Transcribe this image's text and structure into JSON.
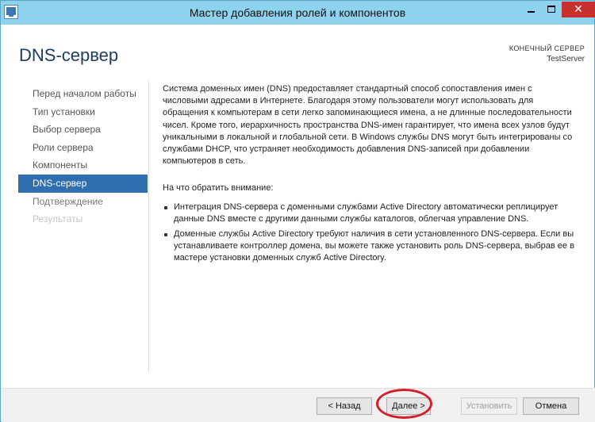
{
  "window": {
    "title": "Мастер добавления ролей и компонентов",
    "controls": {
      "minimize": "",
      "maximize": "",
      "close": "✕"
    }
  },
  "header": {
    "page_title": "DNS-сервер",
    "destination_label": "КОНЕЧНЫЙ СЕРВЕР",
    "destination_value": "TestServer"
  },
  "nav": {
    "items": [
      {
        "label": "Перед началом работы",
        "state": "done"
      },
      {
        "label": "Тип установки",
        "state": "done"
      },
      {
        "label": "Выбор сервера",
        "state": "done"
      },
      {
        "label": "Роли сервера",
        "state": "done"
      },
      {
        "label": "Компоненты",
        "state": "done"
      },
      {
        "label": "DNS-сервер",
        "state": "active"
      },
      {
        "label": "Подтверждение",
        "state": "upcoming"
      },
      {
        "label": "Результаты",
        "state": "disabled"
      }
    ]
  },
  "content": {
    "intro": "Система доменных имен (DNS) предоставляет стандартный способ сопоставления имен с числовыми адресами в Интернете. Благодаря этому пользователи могут использовать для обращения к компьютерам в сети легко запоминающиеся имена, а не длинные последовательности чисел. Кроме того, иерархичность пространства DNS-имен гарантирует, что имена всех узлов будут уникальными в локальной и глобальной сети. В Windows службы DNS могут быть интегрированы со службами DHCP, что устраняет необходимость добавления DNS-записей при добавлении компьютеров в сеть.",
    "notes_title": "На что обратить внимание:",
    "notes": [
      "Интеграция DNS-сервера с доменными службами Active Directory автоматически реплицирует данные DNS вместе с другими данными службы каталогов, облегчая управление DNS.",
      "Доменные службы Active Directory требуют наличия в сети установленного DNS-сервера. Если вы устанавливаете контроллер домена, вы можете также установить роль DNS-сервера, выбрав ее в мастере установки доменных служб Active Directory."
    ]
  },
  "footer": {
    "back": "< Назад",
    "next": "Далее >",
    "install": "Установить",
    "cancel": "Отмена"
  },
  "colors": {
    "titlebar": "#8fd2ee",
    "nav_active": "#2f6fb0",
    "close_button": "#c7302f",
    "highlight": "#d31f2b"
  }
}
